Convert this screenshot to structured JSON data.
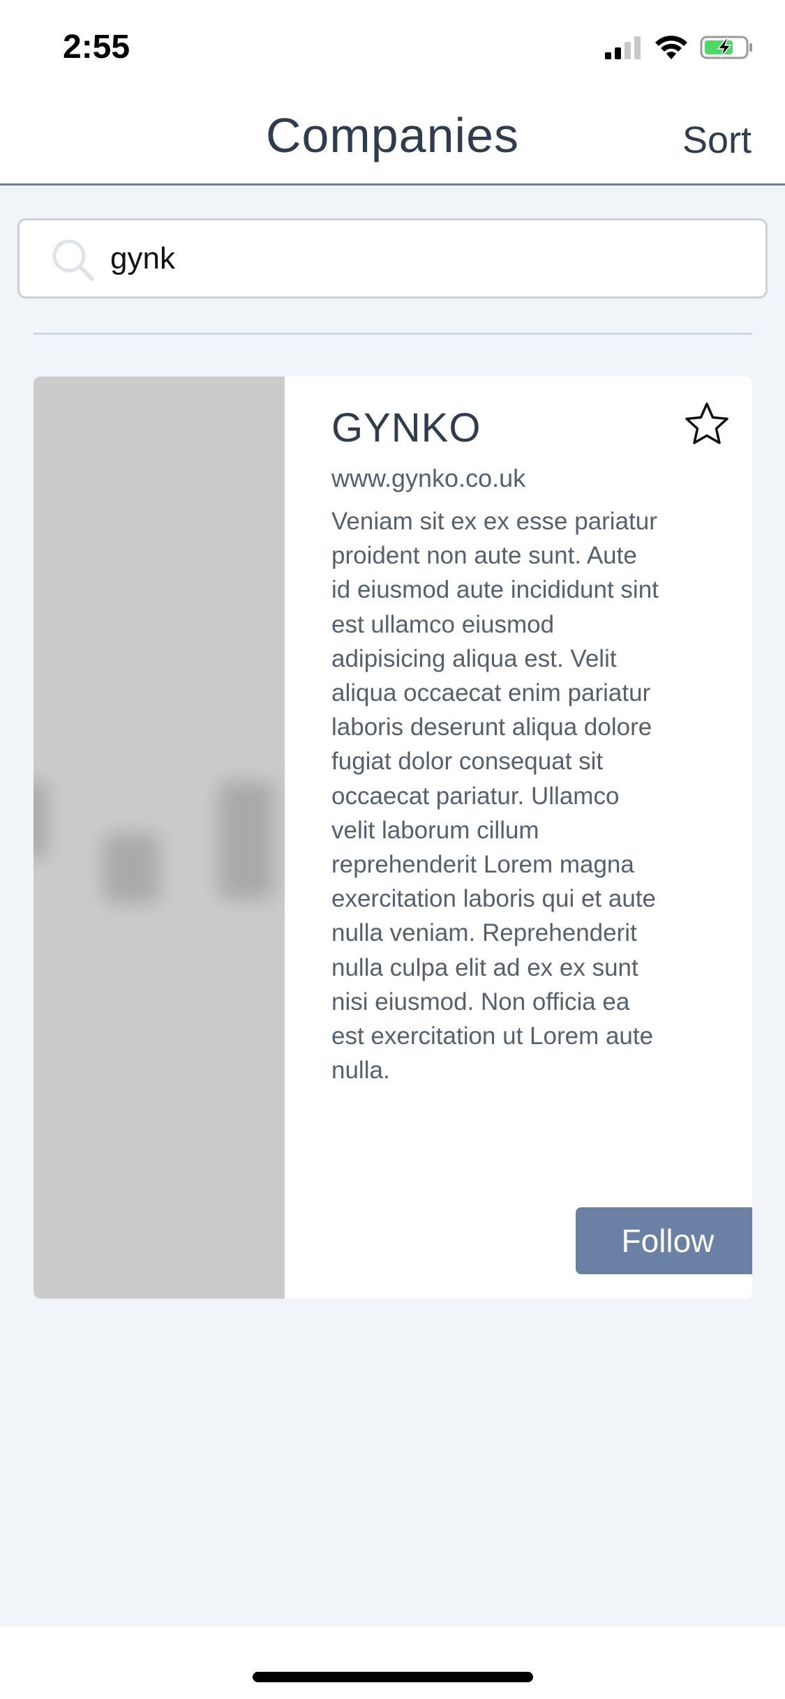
{
  "status_bar": {
    "time": "2:55",
    "icons": [
      "cellular-signal-icon",
      "wifi-icon",
      "battery-charging-icon"
    ]
  },
  "nav": {
    "title": "Companies",
    "sort_label": "Sort"
  },
  "search": {
    "value": "gynk",
    "icon": "search-icon"
  },
  "results": [
    {
      "name": "GYNKO",
      "url": "www.gynko.co.uk",
      "description": "Veniam sit ex ex esse pariatur proident non aute sunt. Aute id eiusmod aute incididunt sint est ullamco eiusmod adipisicing aliqua est. Velit aliqua occaecat enim pariatur laboris deserunt aliqua dolore fugiat dolor consequat sit occaecat pariatur. Ullamco velit laborum cillum reprehenderit Lorem magna exercitation laboris qui et aute nulla veniam. Reprehenderit nulla culpa elit ad ex ex sunt nisi eiusmod. Non officia ea est exercitation ut Lorem aute nulla.",
      "follow_label": "Follow",
      "favorite_icon": "star-outline-icon"
    }
  ],
  "colors": {
    "background": "#f1f4f8",
    "accent": "#6a80a5",
    "text_primary": "#2e3c4d",
    "text_secondary": "#56606c",
    "battery_green": "#4cd964"
  }
}
